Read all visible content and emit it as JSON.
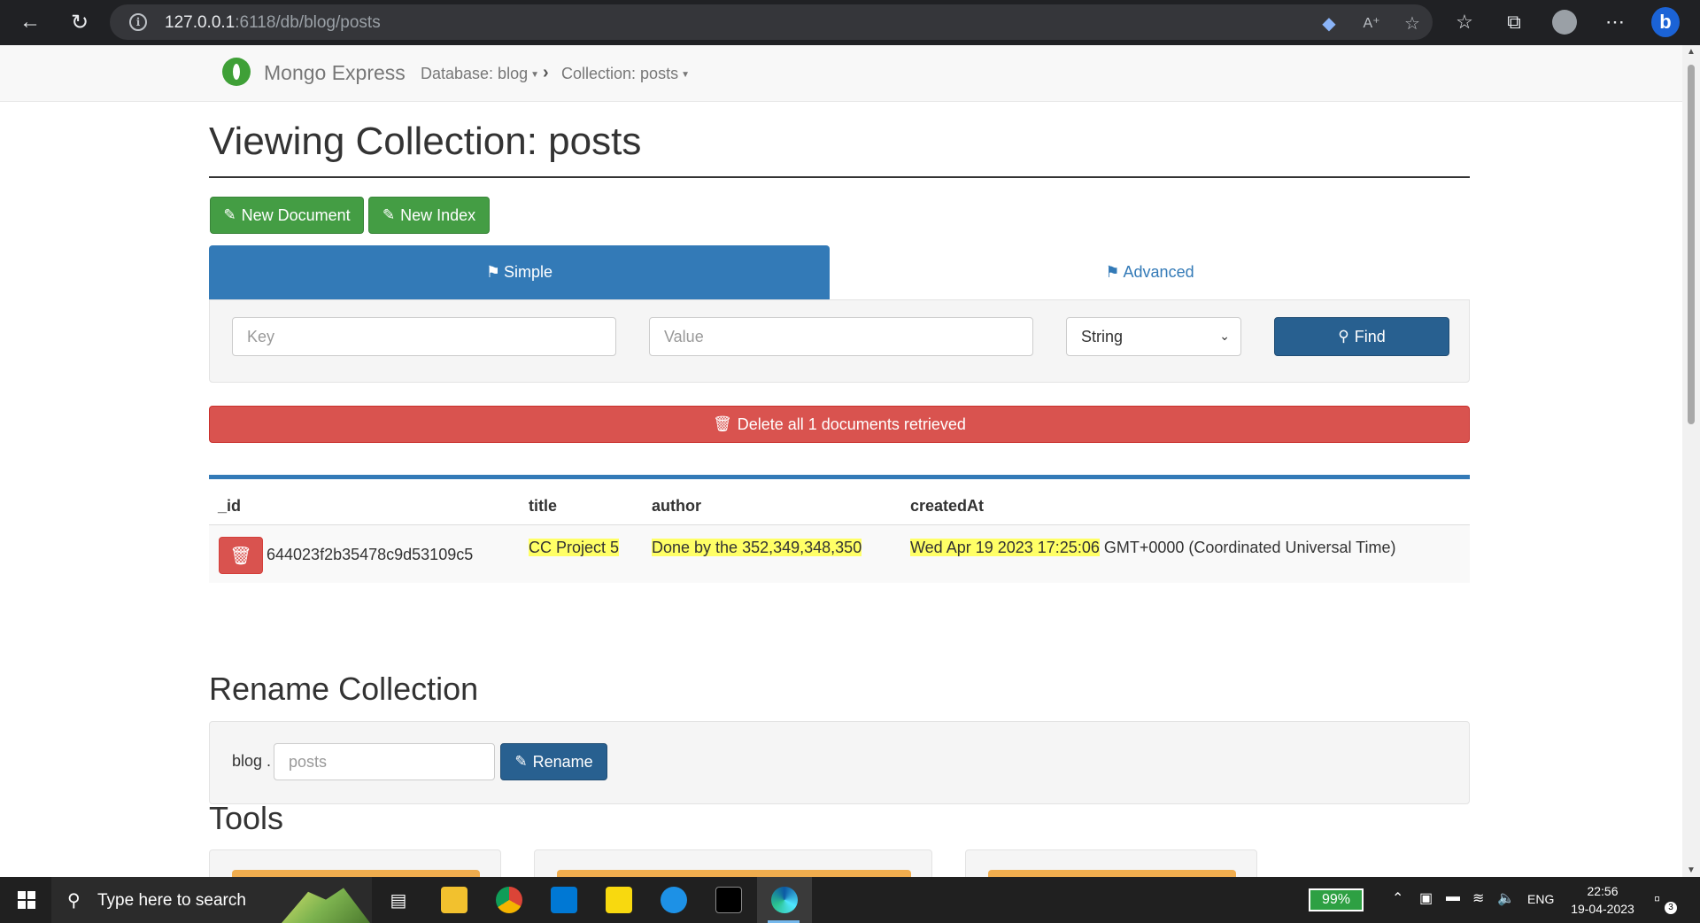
{
  "browser": {
    "url_host": "127.0.0.1",
    "url_rest": ":6118/db/blog/posts"
  },
  "navbar": {
    "brand": "Mongo Express",
    "database_crumb": "Database: blog",
    "collection_crumb": "Collection: posts"
  },
  "page": {
    "title": "Viewing Collection: posts"
  },
  "actions": {
    "new_document": "New Document",
    "new_index": "New Index"
  },
  "tabs": {
    "simple": "Simple",
    "advanced": "Advanced"
  },
  "query": {
    "key_placeholder": "Key",
    "value_placeholder": "Value",
    "type_selected": "String",
    "find_label": "Find"
  },
  "delete_all_label": "Delete all 1 documents retrieved",
  "table": {
    "headers": [
      "_id",
      "title",
      "author",
      "createdAt"
    ],
    "rows": [
      {
        "id": "644023f2b35478c9d53109c5",
        "title": "CC Project 5",
        "author": "Done by the 352,349,348,350",
        "created_highlight": "Wed Apr 19 2023 17:25:06",
        "created_rest": " GMT+0000 (Coordinated Universal Time)"
      }
    ]
  },
  "rename": {
    "heading": "Rename Collection",
    "db_prefix": "blog .",
    "input_placeholder": "posts",
    "button_label": "Rename"
  },
  "tools": {
    "heading": "Tools"
  },
  "taskbar": {
    "search_text": "Type here to search",
    "battery": "99%",
    "language": "ENG",
    "time": "22:56",
    "date": "19-04-2023",
    "notification_count": "3"
  },
  "colors": {
    "primary": "#337ab7",
    "success": "#449d44",
    "danger": "#d9534f",
    "highlight": "#ffff66"
  }
}
